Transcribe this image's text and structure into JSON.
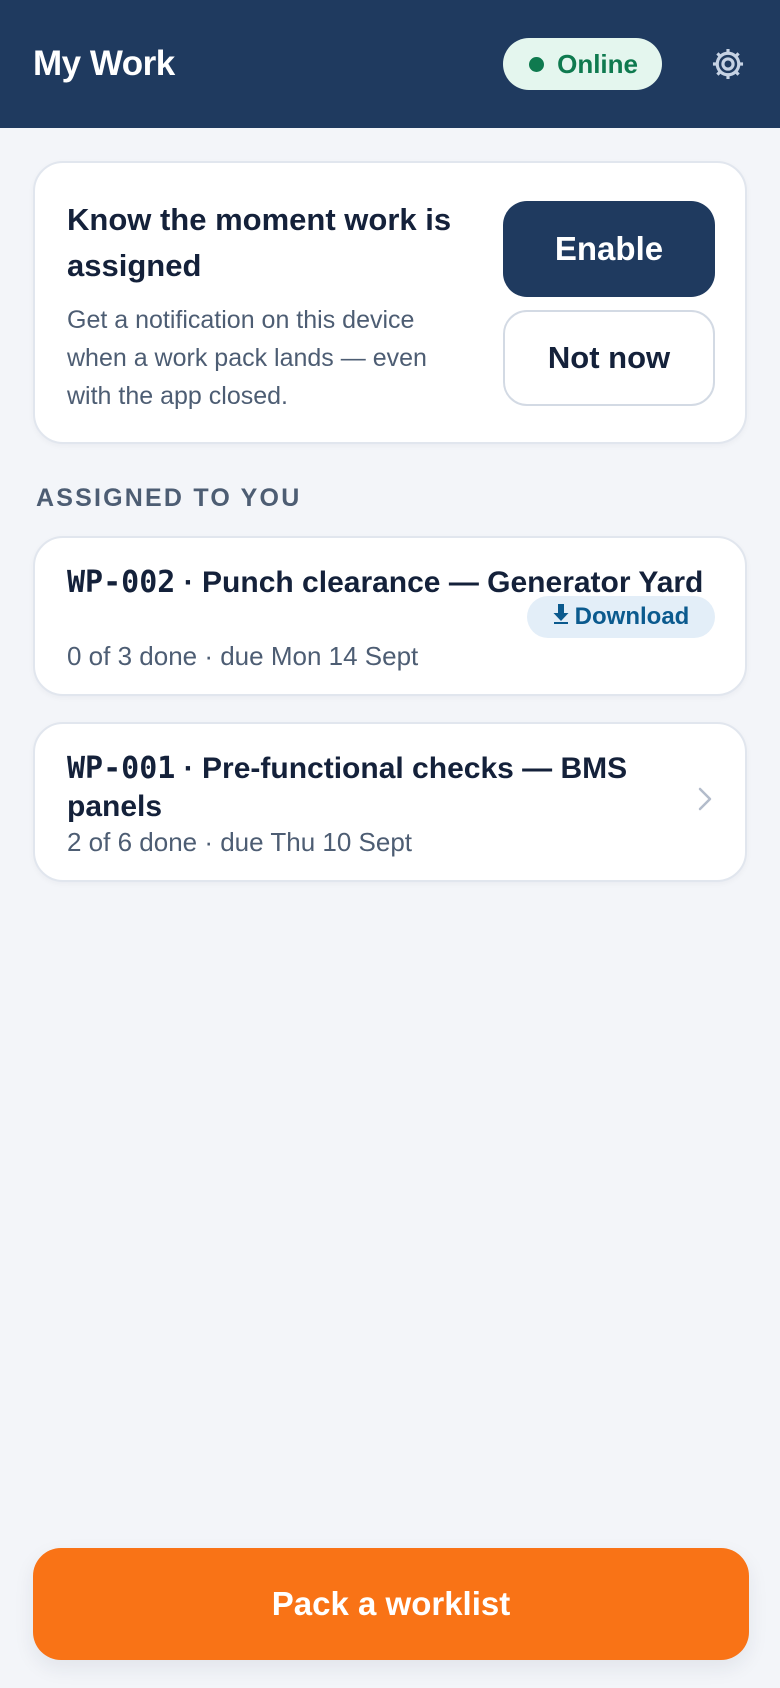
{
  "header": {
    "title": "My Work",
    "status_label": "Online",
    "settings_icon": "gear-icon",
    "colors": {
      "bar": "#1f3a5f",
      "status_bg": "#e4f6ee",
      "status_fg": "#0f7a4f"
    }
  },
  "notification_prompt": {
    "title": "Know the moment work is assigned",
    "body": "Get a notification on this device when a work pack lands — even with the app closed.",
    "enable_label": "Enable",
    "dismiss_label": "Not now"
  },
  "assigned": {
    "section_label": "ASSIGNED TO YOU",
    "items": [
      {
        "code": "WP-002",
        "title": "Punch clearance — Generator Yard",
        "meta": "0 of 3 done · due Mon 14 Sept",
        "action_label": "Download",
        "action_icon": "download-arrow-icon"
      },
      {
        "code": "WP-001",
        "title": "Pre-functional checks — BMS panels",
        "meta": "2 of 6 done · due Thu 10 Sept",
        "action_icon": "chevron-right-icon"
      }
    ]
  },
  "footer": {
    "cta_label": "Pack a worklist",
    "cta_color": "#f97316"
  }
}
